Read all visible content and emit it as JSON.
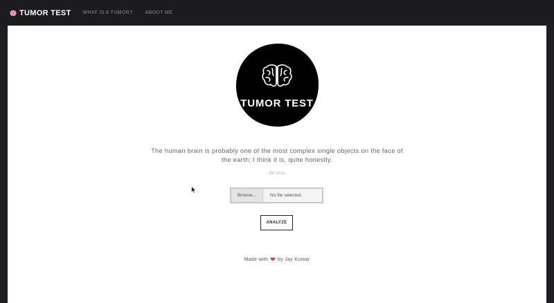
{
  "navbar": {
    "brand": "TUMOR TEST",
    "links": [
      "WHAT IS A TUMOR?",
      "ABOUT ME"
    ]
  },
  "logo": {
    "text": "TUMOR TEST",
    "icon": "brain-icon"
  },
  "quote": {
    "text": "The human brain is probably one of the most complex single objects on the face of the earth; I think it is, quite honestly.",
    "author": "Bill Viola"
  },
  "upload": {
    "browse_label": "Browse...",
    "status": "No file selected."
  },
  "analyze": {
    "label": "ANALYZE"
  },
  "footer": {
    "prefix": "Made with",
    "heart": "❤",
    "suffix": "by Jay Kumar"
  },
  "colors": {
    "navbar_bg": "#1c1b1e",
    "heart": "#e0245e"
  }
}
